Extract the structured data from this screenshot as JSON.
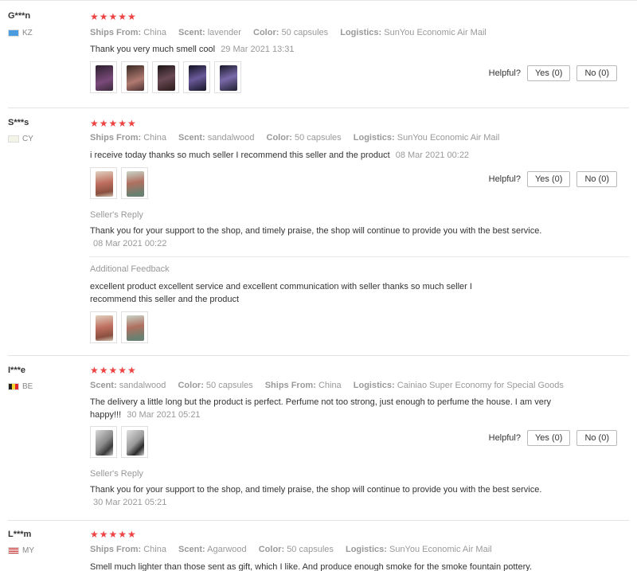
{
  "helpful_label": "Helpful?",
  "reviews": [
    {
      "user": "G***n",
      "country": "KZ",
      "flag_color": "#4b9be0",
      "stars": "★★★★★",
      "meta": [
        {
          "k": "Ships From:",
          "v": "China"
        },
        {
          "k": "Scent:",
          "v": "lavender"
        },
        {
          "k": "Color:",
          "v": "50 capsules"
        },
        {
          "k": "Logistics:",
          "v": "SunYou Economic Air Mail"
        }
      ],
      "text": "Thank you very much smell cool",
      "date": "29 Mar 2021 13:31",
      "yes": "Yes (0)",
      "no": "No (0)"
    },
    {
      "user": "S***s",
      "country": "CY",
      "flag_color": "#f3f3e8",
      "stars": "★★★★★",
      "meta": [
        {
          "k": "Ships From:",
          "v": "China"
        },
        {
          "k": "Scent:",
          "v": "sandalwood"
        },
        {
          "k": "Color:",
          "v": "50 capsules"
        },
        {
          "k": "Logistics:",
          "v": "SunYou Economic Air Mail"
        }
      ],
      "text": "i receive today thanks so much seller I recommend this seller and the product",
      "date": "08 Mar 2021 00:22",
      "yes": "Yes (0)",
      "no": "No (0)",
      "reply_label": "Seller's Reply",
      "reply_text": "Thank you for your support to the shop, and timely praise, the shop will continue to provide you with the best service.",
      "reply_date": "08 Mar 2021 00:22",
      "additional_label": "Additional Feedback",
      "additional_text": "excellent product excellent service and excellent communication with seller thanks so much seller I recommend this seller and the product"
    },
    {
      "user": "I***e",
      "country": "BE",
      "flag_color": "#f6d32d",
      "stars": "★★★★★",
      "meta": [
        {
          "k": "Scent:",
          "v": "sandalwood"
        },
        {
          "k": "Color:",
          "v": "50 capsules"
        },
        {
          "k": "Ships From:",
          "v": "China"
        },
        {
          "k": "Logistics:",
          "v": "Cainiao Super Economy for Special Goods"
        }
      ],
      "text": "The delivery a little long but the product is perfect. Perfume not too strong, just enough to perfume the house. I am very happy!!!",
      "date": "30 Mar 2021 05:21",
      "yes": "Yes (0)",
      "no": "No (0)",
      "reply_label": "Seller's Reply",
      "reply_text": "Thank you for your support to the shop, and timely praise, the shop will continue to provide you with the best service.",
      "reply_date": "30 Mar 2021 05:21"
    },
    {
      "user": "L***m",
      "country": "MY",
      "flag_color": "#cc3333",
      "stars": "★★★★★",
      "meta": [
        {
          "k": "Ships From:",
          "v": "China"
        },
        {
          "k": "Scent:",
          "v": "Agarwood"
        },
        {
          "k": "Color:",
          "v": "50 capsules"
        },
        {
          "k": "Logistics:",
          "v": "SunYou Economic Air Mail"
        }
      ],
      "text": "Smell much lighter than those sent as gift, which I like. And produce enough smoke for the smoke fountain pottery."
    }
  ]
}
